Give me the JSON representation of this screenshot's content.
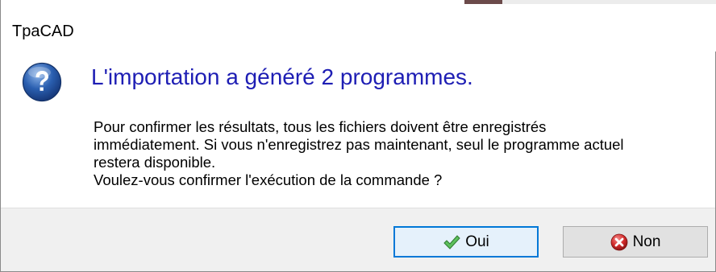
{
  "window": {
    "title": "TpaCAD"
  },
  "dialog": {
    "icon": "question-icon",
    "main_instruction": "L'importation a généré 2 programmes.",
    "body_lines": [
      "Pour confirmer les résultats, tous les fichiers doivent être enregistrés",
      "immédiatement. Si vous n'enregistrez pas maintenant, seul le programme actuel",
      "restera disponible.",
      "Voulez-vous confirmer l'exécution de la commande ?"
    ]
  },
  "buttons": {
    "yes_label": "Oui",
    "yes_icon": "checkmark-icon",
    "no_label": "Non",
    "no_icon": "error-x-icon"
  },
  "colors": {
    "main_instruction": "#1e1eb4",
    "footer_bg": "#f0f0f0",
    "default_button_border": "#0078d7",
    "question_icon": "#2a5fb0",
    "check_icon": "#3fa83f",
    "error_icon": "#d22a2a"
  }
}
